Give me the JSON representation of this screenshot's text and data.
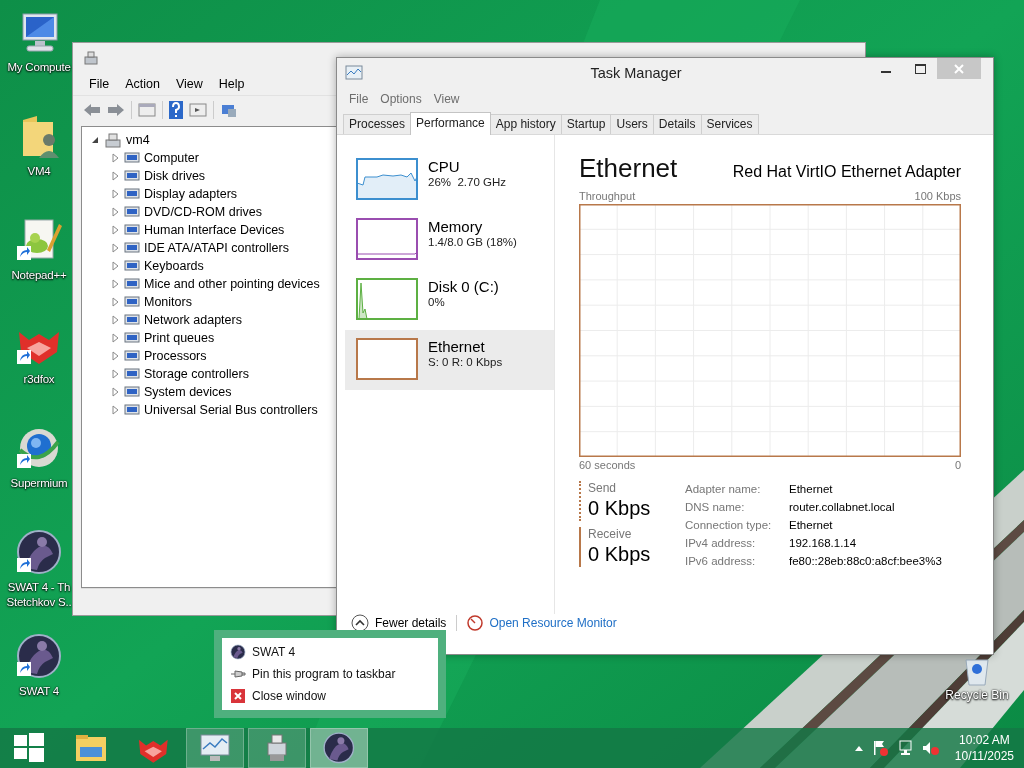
{
  "desktop_icons": [
    {
      "label": "My Compute",
      "kind": "computer",
      "shortcut": false
    },
    {
      "label": "VM4",
      "kind": "user-folder",
      "shortcut": false
    },
    {
      "label": "Notepad++",
      "kind": "notepad",
      "shortcut": true
    },
    {
      "label": "r3dfox",
      "kind": "fox",
      "shortcut": true
    },
    {
      "label": "Supermium",
      "kind": "globe",
      "shortcut": true
    },
    {
      "label": "SWAT 4 - Th\nStetchkov S..",
      "kind": "game",
      "shortcut": true
    },
    {
      "label": "SWAT 4",
      "kind": "game",
      "shortcut": true
    }
  ],
  "recycle_bin": {
    "label": "Recycle Bin"
  },
  "device_manager": {
    "menu": [
      "File",
      "Action",
      "View",
      "Help"
    ],
    "tree": {
      "label": "vm4",
      "expanded": true,
      "children": [
        {
          "label": "Computer",
          "expanded": false
        },
        {
          "label": "Disk drives",
          "expanded": false
        },
        {
          "label": "Display adapters",
          "expanded": false
        },
        {
          "label": "DVD/CD-ROM drives",
          "expanded": false
        },
        {
          "label": "Human Interface Devices",
          "expanded": false
        },
        {
          "label": "IDE ATA/ATAPI controllers",
          "expanded": false
        },
        {
          "label": "Keyboards",
          "expanded": false
        },
        {
          "label": "Mice and other pointing devices",
          "expanded": false
        },
        {
          "label": "Monitors",
          "expanded": false
        },
        {
          "label": "Network adapters",
          "expanded": false
        },
        {
          "label": "Print queues",
          "expanded": false
        },
        {
          "label": "Processors",
          "expanded": false
        },
        {
          "label": "Storage controllers",
          "expanded": false
        },
        {
          "label": "System devices",
          "expanded": false
        },
        {
          "label": "Universal Serial Bus controllers",
          "expanded": false
        }
      ]
    }
  },
  "task_manager": {
    "title": "Task Manager",
    "menu": [
      "File",
      "Options",
      "View"
    ],
    "tabs": [
      {
        "label": "Processes",
        "selected": false
      },
      {
        "label": "Performance",
        "selected": true
      },
      {
        "label": "App history",
        "selected": false
      },
      {
        "label": "Startup",
        "selected": false
      },
      {
        "label": "Users",
        "selected": false
      },
      {
        "label": "Details",
        "selected": false
      },
      {
        "label": "Services",
        "selected": false
      }
    ],
    "resources": [
      {
        "name": "CPU",
        "reading": "26%  2.70 GHz",
        "kind": "cpu",
        "color": "#3c8fcf",
        "selected": false
      },
      {
        "name": "Memory",
        "reading": "1.4/8.0 GB (18%)",
        "kind": "memory",
        "color": "#9a4db0",
        "selected": false
      },
      {
        "name": "Disk 0 (C:)",
        "reading": "0%",
        "kind": "disk",
        "color": "#5db043",
        "selected": false
      },
      {
        "name": "Ethernet",
        "reading": "S: 0 R: 0 Kbps",
        "kind": "network",
        "color": "#b8784a",
        "selected": true
      }
    ],
    "detail": {
      "title": "Ethernet",
      "adapter": "Red Hat VirtIO Ethernet Adapter",
      "graph_label": "Throughput",
      "graph_max": "100 Kbps",
      "graph_span": "60 seconds",
      "graph_min": "0",
      "send": {
        "label": "Send",
        "value": "0 Kbps"
      },
      "receive": {
        "label": "Receive",
        "value": "0 Kbps"
      },
      "properties": [
        {
          "label": "Adapter name:",
          "value": "Ethernet"
        },
        {
          "label": "DNS name:",
          "value": "router.collabnet.local"
        },
        {
          "label": "Connection type:",
          "value": "Ethernet"
        },
        {
          "label": "IPv4 address:",
          "value": "192.168.1.14"
        },
        {
          "label": "IPv6 address:",
          "value": "fe80::28eb:88c0:a8cf:bee3%3"
        }
      ]
    },
    "footer": {
      "fewer": "Fewer details",
      "link": "Open Resource Monitor"
    }
  },
  "jump_list": {
    "title": "SWAT 4",
    "items": [
      {
        "label": "Pin this program to taskbar",
        "kind": "pin"
      },
      {
        "label": "Close window",
        "kind": "close"
      }
    ]
  },
  "taskbar": {
    "buttons": [
      {
        "kind": "start",
        "running": false,
        "selected": false
      },
      {
        "kind": "explorer",
        "running": false,
        "selected": false
      },
      {
        "kind": "fox",
        "running": false,
        "selected": false
      },
      {
        "kind": "task-manager",
        "running": true,
        "selected": false
      },
      {
        "kind": "device-manager",
        "running": true,
        "selected": false
      },
      {
        "kind": "game",
        "running": true,
        "selected": true
      }
    ],
    "time": "10:02 AM",
    "date": "10/11/2025"
  }
}
